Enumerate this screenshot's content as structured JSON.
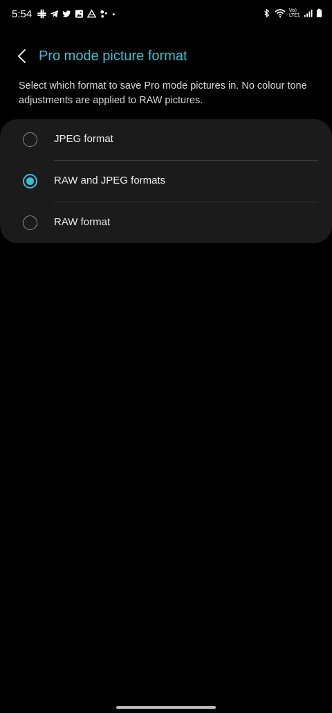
{
  "status_bar": {
    "time": "5:54",
    "left_icons": [
      "slack-icon",
      "telegram-icon",
      "twitter-icon",
      "gallery-icon",
      "drive-icon",
      "assistant-icon",
      "more-dot-icon"
    ],
    "right_icons": [
      "bluetooth-icon",
      "wifi-icon",
      "volte-lte-icon",
      "signal-icon",
      "battery-icon"
    ],
    "network_label_top": "Vo)",
    "network_label_bottom": "LTE1"
  },
  "header": {
    "title": "Pro mode picture format"
  },
  "description": "Select which format to save Pro mode pictures in. No colour tone adjustments are applied to RAW pictures.",
  "options": [
    {
      "label": "JPEG format",
      "selected": false
    },
    {
      "label": "RAW and JPEG formats",
      "selected": true
    },
    {
      "label": "RAW format",
      "selected": false
    }
  ],
  "colors": {
    "accent": "#35c2d6",
    "background": "#000000",
    "card": "#1b1b1b"
  }
}
